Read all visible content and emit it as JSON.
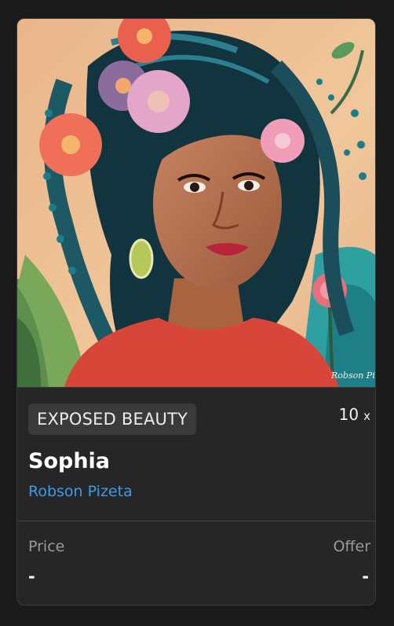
{
  "artwork": {
    "image": "portrait-painting-woman-with-flowers-in-braided-hair",
    "signature": "Robson Pizeta"
  },
  "collection": "EXPOSED BEAUTY",
  "edition": {
    "count": "10",
    "unit": "x"
  },
  "title": "Sophia",
  "artist": "Robson Pizeta",
  "price": {
    "label": "Price",
    "value": "-"
  },
  "offer": {
    "label": "Offer",
    "value": "-"
  },
  "colors": {
    "card_background": "#262626",
    "badge_background": "#3a3a3a",
    "artist_link": "#3e9be8",
    "label_text": "#9a9a9a"
  }
}
